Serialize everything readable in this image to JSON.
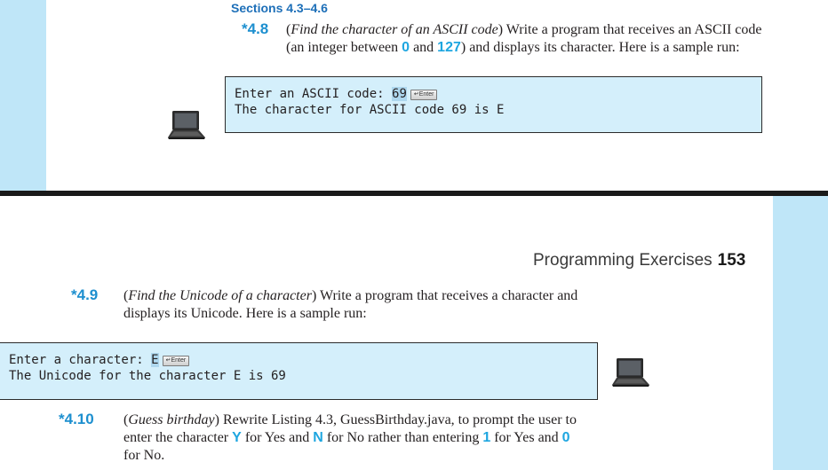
{
  "top": {
    "section_heading": "Sections 4.3–4.6",
    "exercise": {
      "number": "*4.8",
      "title": "Find the character of an ASCII code",
      "text_a": " Write a program that receives an ASCII code",
      "text_b": "(an integer between ",
      "kw1": "0",
      "text_c": " and ",
      "kw2": "127",
      "text_d": ") and displays its character. Here is a sample run:"
    },
    "console": {
      "prompt": "Enter an ASCII code: ",
      "input": "69",
      "enter_key": "↵Enter",
      "output": "The character for ASCII code 69 is E"
    }
  },
  "bottom": {
    "header": {
      "title": "Programming Exercises",
      "page": "153"
    },
    "exercise_9": {
      "number": "*4.9",
      "title": "Find the Unicode of a character",
      "text_a": " Write a program that receives a character and",
      "text_b": "displays its Unicode. Here is a sample run:"
    },
    "console": {
      "prompt": "Enter a character: ",
      "input": "E",
      "enter_key": "↵Enter",
      "output": "The Unicode for the character E is 69"
    },
    "exercise_10": {
      "number": "*4.10",
      "title": "Guess birthday",
      "text_a": " Rewrite Listing 4.3, GuessBirthday.java, to prompt the user to",
      "text_b1": "enter the character ",
      "kw_y": "Y",
      "text_b2": " for Yes and ",
      "kw_n": "N",
      "text_b3": " for No rather than entering ",
      "kw_1": "1",
      "text_b4": " for Yes and ",
      "kw_0": "0",
      "text_c": "for No."
    }
  },
  "colors": {
    "band": "#bfe6f8",
    "console_bg": "#d4effb",
    "accent_blue": "#1d8fcf",
    "keyword_cyan": "#1ea6e0"
  },
  "icons": [
    "laptop-icon",
    "enter-key-icon"
  ]
}
